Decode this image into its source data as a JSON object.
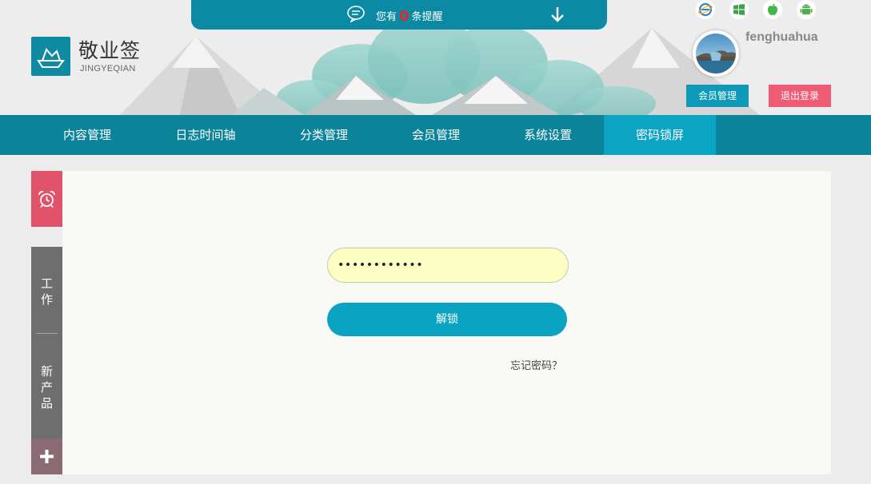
{
  "colors": {
    "primary": "#0b8399",
    "active_tab": "#0ba4c3",
    "logout_button": "#ef5a74",
    "notice_count": "#e0262f",
    "alarm_tab": "#e0536b",
    "side_tab": "#6e6e6e",
    "password_field": "#fbffc4"
  },
  "notice": {
    "prefix": "您有",
    "count": "0",
    "suffix": "条提醒",
    "icons": [
      "speech-bubble-icon",
      "arrow-down-icon"
    ]
  },
  "brand": {
    "name": "敬业签",
    "subtitle": "JINGYEQIAN",
    "icon": "boat-logo-icon"
  },
  "platforms": [
    "ie-icon",
    "windows-icon",
    "apple-icon",
    "android-icon"
  ],
  "user": {
    "name": "fenghuahua",
    "member_button": "会员管理",
    "logout_button": "退出登录"
  },
  "nav": {
    "items": [
      {
        "label": "内容管理"
      },
      {
        "label": "日志时间轴"
      },
      {
        "label": "分类管理"
      },
      {
        "label": "会员管理"
      },
      {
        "label": "系统设置"
      },
      {
        "label": "密码锁屏"
      }
    ],
    "active": "密码锁屏"
  },
  "side": {
    "alarm_icon": "alarm-clock-icon",
    "tab1": "工\n作",
    "tab2": "新\n产\n品",
    "add_icon": "plus-icon"
  },
  "lock": {
    "password_value": "••••••••••••",
    "unlock_label": "解锁",
    "forgot_label": "忘记密码？"
  }
}
